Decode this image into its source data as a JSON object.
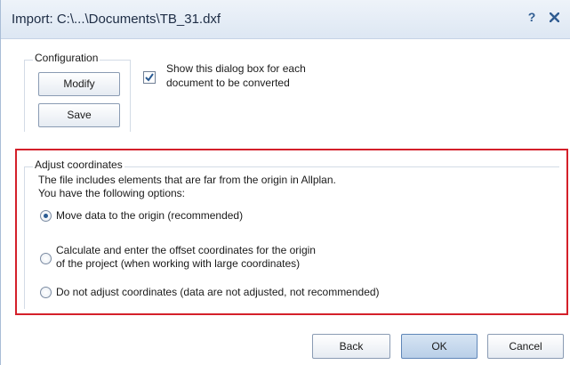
{
  "window": {
    "title": "Import: C:\\...\\Documents\\TB_31.dxf",
    "help_label": "?",
    "close_icon": "close-icon"
  },
  "configuration": {
    "legend": "Configuration",
    "modify_label": "Modify",
    "save_label": "Save",
    "show_dialog_checked": true,
    "show_dialog_line1": "Show this dialog box for each",
    "show_dialog_line2": "document to be converted"
  },
  "adjust": {
    "legend": "Adjust coordinates",
    "description_line1": "The file includes elements that are far from the origin in Allplan.",
    "description_line2": "You have the following options:",
    "options": [
      {
        "line1": "Move data to the origin (recommended)",
        "checked": true
      },
      {
        "line1": "Calculate and enter the offset coordinates for the origin",
        "line2": "of the project (when working with large coordinates)",
        "checked": false
      },
      {
        "line1": "Do not adjust coordinates (data are not adjusted, not recommended)",
        "checked": false
      }
    ],
    "highlight_color": "#d4202a"
  },
  "footer": {
    "back_label": "Back",
    "ok_label": "OK",
    "cancel_label": "Cancel"
  }
}
